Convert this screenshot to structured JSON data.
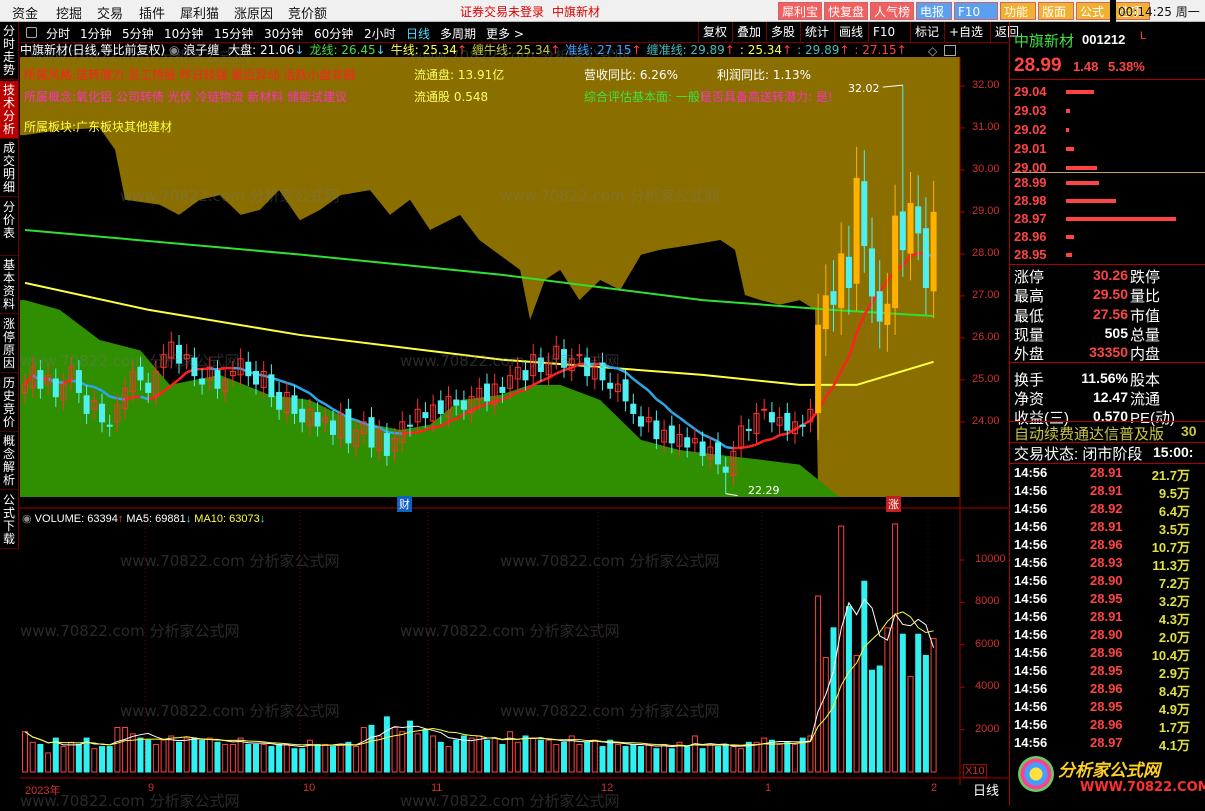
{
  "menu": [
    "资金",
    "挖掘",
    "交易",
    "插件",
    "犀利猫",
    "涨原因",
    "竞价额"
  ],
  "status_text": "证券交易未登录",
  "status_stock": "中旗新材",
  "top_buttons": [
    {
      "label": "犀利宝",
      "color": "#f06060"
    },
    {
      "label": "快复盘",
      "color": "#f06060"
    },
    {
      "label": "人气榜",
      "color": "#f06060"
    },
    {
      "label": "电报",
      "color": "#5aa0f0"
    },
    {
      "label": "F10",
      "color": "#5aa0f0"
    },
    {
      "label": "功能",
      "color": "#f0b030"
    },
    {
      "label": "版面",
      "color": "#f0b030"
    },
    {
      "label": "公式",
      "color": "#f0b030"
    },
    {
      "label": "选项",
      "color": "#f0b030"
    }
  ],
  "clock": "00:14:25 周一",
  "side_tabs": [
    "分时走势",
    "技术分析",
    "成交明细",
    "分价表",
    "基本资料",
    "涨停原因",
    "历史竞价",
    "概念解析",
    "公式下载"
  ],
  "periods": [
    "分时",
    "1分钟",
    "5分钟",
    "10分钟",
    "15分钟",
    "30分钟",
    "60分钟",
    "2小时",
    "日线",
    "多周期",
    "更多 >"
  ],
  "active_period": "日线",
  "chart_tools": [
    "复权",
    "叠加",
    "多股",
    "统计",
    "画线",
    "F10",
    "标记",
    "+自选",
    "返回"
  ],
  "header": {
    "title": "中旗新材(日线,等比前复权)",
    "indicator": "浪子缠",
    "items": [
      {
        "label": "大盘: 21.06",
        "arrow": "↓",
        "color": "#ffffff"
      },
      {
        "label": "龙线: 26.45",
        "arrow": "↓",
        "color": "#40e040"
      },
      {
        "label": "牛线: 25.34",
        "arrow": "↑",
        "color": "#ffff40"
      },
      {
        "label": "缠牛线: 25.34",
        "arrow": "↑",
        "color": "#c8c840"
      },
      {
        "label": "准线: 27.15",
        "arrow": "↑",
        "color": "#40a0ff"
      },
      {
        "label": "缠准线: 29.89",
        "arrow": "↑",
        "color": "#40c0c0"
      },
      {
        "label": ": 25.34",
        "arrow": "↑",
        "color": "#ffff40"
      },
      {
        "label": ": 29.89",
        "arrow": "↑",
        "color": "#40c0c0"
      },
      {
        "label": ": 27.15",
        "arrow": "↑",
        "color": "#ff4040"
      }
    ]
  },
  "info": {
    "style": "所属风格:送转潜力 员工持股 昨日较强 最近异动 活跃小盘非融",
    "concept": "所属概念:氧化铝 公司转债 光伏 冷链物流 新材料 储能试建议",
    "sector": "所属板块:广东板块其他建材",
    "float_cap": "流通盘: 13.91亿",
    "float_shares": "流通股  0.548",
    "revenue_yoy": "营收同比: 6.26%",
    "profit_yoy": "利润同比: 1.13%",
    "eval_label": "综合评估基本面: 一般!",
    "eval_transfer": "是否具备高送转潜力: 是!"
  },
  "price_axis": [
    "32.00",
    "31.00",
    "30.00",
    "29.00",
    "28.00",
    "27.00",
    "26.00",
    "25.00",
    "24.00"
  ],
  "volume_header": {
    "volume": "VOLUME: 63394",
    "ma5": "MA5: 69881",
    "ma10": "MA10: 63073"
  },
  "volume_axis": [
    "10000",
    "8000",
    "6000",
    "4000",
    "2000"
  ],
  "volume_unit": "X10",
  "x_labels": [
    "2023年",
    "9",
    "10",
    "11",
    "12",
    "1",
    "2"
  ],
  "x_mode": "日线",
  "markers": [
    "财",
    "涨"
  ],
  "chart_data": {
    "type": "candlestick",
    "ylim": [
      22.21,
      32.69
    ],
    "volume_ylim": [
      0,
      12400
    ],
    "closes": [
      24.9,
      25.3,
      24.8,
      25.1,
      24.6,
      24.9,
      25.3,
      24.7,
      24.2,
      24.5,
      24.0,
      23.9,
      24.4,
      24.8,
      25.2,
      25.0,
      24.7,
      25.2,
      25.6,
      25.9,
      25.4,
      25.6,
      25.1,
      24.9,
      25.3,
      24.8,
      25.0,
      25.2,
      25.5,
      25.1,
      24.9,
      25.2,
      24.6,
      24.3,
      24.7,
      24.2,
      24.0,
      24.3,
      23.9,
      24.1,
      23.7,
      24.2,
      23.5,
      23.8,
      24.0,
      23.4,
      23.8,
      23.2,
      23.6,
      24.0,
      23.9,
      24.3,
      24.1,
      24.4,
      24.2,
      24.6,
      24.4,
      24.3,
      24.6,
      24.8,
      24.5,
      24.9,
      24.7,
      25.1,
      25.3,
      25.0,
      25.6,
      25.2,
      25.4,
      25.8,
      25.3,
      25.5,
      25.6,
      25.1,
      25.3,
      25.0,
      24.8,
      24.9,
      24.5,
      24.2,
      23.9,
      24.1,
      23.6,
      23.8,
      23.5,
      23.7,
      23.4,
      23.6,
      23.2,
      23.4,
      23.0,
      22.8,
      23.3,
      23.9,
      23.8,
      24.2,
      24.3,
      24.0,
      24.1,
      23.8,
      24.0,
      23.9,
      24.3,
      26.3,
      27.0,
      26.8,
      28.0,
      27.2,
      29.8,
      28.2,
      27.0,
      26.4,
      26.8,
      28.9,
      28.1,
      29.2,
      28.5,
      27.2,
      28.99
    ],
    "volumes": [
      1900,
      1400,
      1300,
      900,
      1600,
      1200,
      1400,
      1300,
      1600,
      1100,
      1200,
      1200,
      2100,
      2100,
      1800,
      1600,
      1500,
      1300,
      1500,
      1700,
      1400,
      1600,
      1600,
      1500,
      1600,
      1400,
      1300,
      1300,
      1600,
      1300,
      1300,
      1300,
      1200,
      1300,
      1300,
      1100,
      1100,
      1500,
      1300,
      1300,
      1200,
      1300,
      1400,
      1200,
      2100,
      2200,
      1700,
      2600,
      2100,
      1900,
      2400,
      1800,
      2000,
      1700,
      1400,
      1200,
      1500,
      1700,
      1600,
      1700,
      1500,
      1600,
      1300,
      1900,
      1400,
      1700,
      1600,
      1500,
      1500,
      1300,
      1400,
      1700,
      1300,
      1400,
      1500,
      1200,
      1500,
      1300,
      1200,
      1300,
      1200,
      1300,
      1100,
      1300,
      1100,
      1400,
      1200,
      1700,
      1100,
      1300,
      1200,
      1300,
      1200,
      1100,
      1400,
      1400,
      1600,
      1500,
      1300,
      1400,
      1300,
      1600,
      1700,
      8300,
      5400,
      6800,
      11600,
      7800,
      5500,
      9000,
      4800,
      5000,
      6800,
      11700,
      6500,
      4500,
      6500,
      5500,
      6300
    ],
    "marked_high": {
      "index": 114,
      "value": "32.02"
    },
    "marked_low": {
      "index": 91,
      "value": "22.29"
    },
    "band_upper": [
      [
        0,
        30.83
      ],
      [
        4.5,
        30.95
      ],
      [
        9.7,
        31.0
      ],
      [
        11.7,
        30.48
      ],
      [
        13,
        29.29
      ],
      [
        17.5,
        29.17
      ],
      [
        20,
        28.93
      ],
      [
        22.7,
        29.29
      ],
      [
        25.3,
        29.4
      ],
      [
        28,
        28.93
      ],
      [
        30.5,
        29.05
      ],
      [
        33,
        29.52
      ],
      [
        35.7,
        28.8
      ],
      [
        38.3,
        29.05
      ],
      [
        41,
        29.4
      ],
      [
        44.8,
        29.52
      ],
      [
        47.4,
        28.93
      ],
      [
        50,
        29.29
      ],
      [
        52.6,
        28.57
      ],
      [
        56.5,
        28.93
      ],
      [
        59,
        28.33
      ],
      [
        64.3,
        27.62
      ],
      [
        65.6,
        26.43
      ],
      [
        67.5,
        27.38
      ],
      [
        69.5,
        27.62
      ],
      [
        72,
        26.9
      ],
      [
        74.7,
        27.38
      ],
      [
        77.3,
        27.14
      ],
      [
        80,
        27.98
      ],
      [
        82.5,
        28.1
      ],
      [
        86.4,
        28.21
      ],
      [
        90.3,
        28.33
      ],
      [
        92.2,
        28.1
      ],
      [
        93.5,
        27.02
      ],
      [
        95.5,
        26.9
      ],
      [
        98,
        26.79
      ],
      [
        100.6,
        26.9
      ],
      [
        102.6,
        26.67
      ],
      [
        103,
        22.21
      ],
      [
        121,
        22.21
      ]
    ],
    "band_lower": [
      [
        0,
        26.9
      ],
      [
        4.5,
        26.67
      ],
      [
        9.7,
        25.95
      ],
      [
        15,
        25.7
      ],
      [
        18.8,
        24.88
      ],
      [
        25.3,
        25.12
      ],
      [
        31.8,
        24.64
      ],
      [
        37,
        24.52
      ],
      [
        42.2,
        24.05
      ],
      [
        48.7,
        23.81
      ],
      [
        52.6,
        23.93
      ],
      [
        56.5,
        24.52
      ],
      [
        61.7,
        24.64
      ],
      [
        65.6,
        24.88
      ],
      [
        69.5,
        24.88
      ],
      [
        74.7,
        24.52
      ],
      [
        80,
        23.57
      ],
      [
        85,
        23.33
      ],
      [
        90.3,
        23.21
      ],
      [
        95.5,
        23.1
      ],
      [
        100.6,
        22.98
      ],
      [
        105.8,
        22.21
      ]
    ],
    "line_green": [
      [
        0,
        28.57
      ],
      [
        36,
        27.98
      ],
      [
        62,
        27.5
      ],
      [
        88,
        26.9
      ],
      [
        104.5,
        26.67
      ],
      [
        118,
        26.52
      ]
    ],
    "line_yellow": [
      [
        0,
        27.31
      ],
      [
        16,
        26.67
      ],
      [
        35.7,
        26.07
      ],
      [
        62,
        25.48
      ],
      [
        88,
        25.12
      ],
      [
        100.6,
        24.88
      ],
      [
        108,
        24.88
      ],
      [
        118,
        25.43
      ]
    ]
  },
  "quote": {
    "name": "中旗新材",
    "code": "001212",
    "flag": "L",
    "price": "28.99",
    "change": "1.48",
    "pct": "5.38%"
  },
  "asks": [
    {
      "price": "29.04",
      "size": 0.25
    },
    {
      "price": "29.03",
      "size": 0.04
    },
    {
      "price": "29.02",
      "size": 0.02
    },
    {
      "price": "29.01",
      "size": 0.07
    },
    {
      "price": "29.00",
      "size": 0.28
    }
  ],
  "bids": [
    {
      "price": "28.99",
      "size": 0.3
    },
    {
      "price": "28.98",
      "size": 0.45
    },
    {
      "price": "28.97",
      "size": 1.0
    },
    {
      "price": "28.96",
      "size": 0.07
    },
    {
      "price": "28.95",
      "size": 0.05
    }
  ],
  "stats": [
    {
      "l": "涨停",
      "v": "30.26",
      "r": "跌停",
      "c": "#ff4444"
    },
    {
      "l": "最高",
      "v": "29.50",
      "r": "量比",
      "c": "#ff4444"
    },
    {
      "l": "最低",
      "v": "27.56",
      "r": "市值",
      "c": "#ff4444"
    },
    {
      "l": "现量",
      "v": "505",
      "r": "总量",
      "c": "#ffffff"
    },
    {
      "l": "外盘",
      "v": "33350",
      "r": "内盘",
      "c": "#ff4444"
    },
    {
      "l": "换手",
      "v": "11.56%",
      "r": "股本",
      "c": "#ffffff"
    },
    {
      "l": "净资",
      "v": "12.47",
      "r": "流通",
      "c": "#ffffff"
    },
    {
      "l": "收益(三)",
      "v": "0.570",
      "r": "PE(动)",
      "c": "#ffffff"
    }
  ],
  "ad_text": "自动续费通达信普及版",
  "ad_num": "30",
  "trade_state": "交易状态: 闭市阶段",
  "trade_time": "15:00:",
  "trades": [
    {
      "t": "14:56",
      "p": "28.91",
      "v": "21.7万"
    },
    {
      "t": "14:56",
      "p": "28.91",
      "v": "9.5万"
    },
    {
      "t": "14:56",
      "p": "28.92",
      "v": "6.4万"
    },
    {
      "t": "14:56",
      "p": "28.91",
      "v": "3.5万"
    },
    {
      "t": "14:56",
      "p": "28.96",
      "v": "10.7万"
    },
    {
      "t": "14:56",
      "p": "28.93",
      "v": "11.3万"
    },
    {
      "t": "14:56",
      "p": "28.90",
      "v": "7.2万"
    },
    {
      "t": "14:56",
      "p": "28.95",
      "v": "3.2万"
    },
    {
      "t": "14:56",
      "p": "28.91",
      "v": "4.3万"
    },
    {
      "t": "14:56",
      "p": "28.90",
      "v": "2.0万"
    },
    {
      "t": "14:56",
      "p": "28.96",
      "v": "10.4万"
    },
    {
      "t": "14:56",
      "p": "28.95",
      "v": "2.9万"
    },
    {
      "t": "14:56",
      "p": "28.96",
      "v": "8.4万"
    },
    {
      "t": "14:56",
      "p": "28.95",
      "v": "4.9万"
    },
    {
      "t": "14:56",
      "p": "28.96",
      "v": "1.7万"
    },
    {
      "t": "14:56",
      "p": "28.97",
      "v": "4.1万"
    }
  ],
  "logo": {
    "title": "分析家公式网",
    "url": "WWW.70822.COM"
  },
  "watermark": "www.70822.com 分析家公式网"
}
